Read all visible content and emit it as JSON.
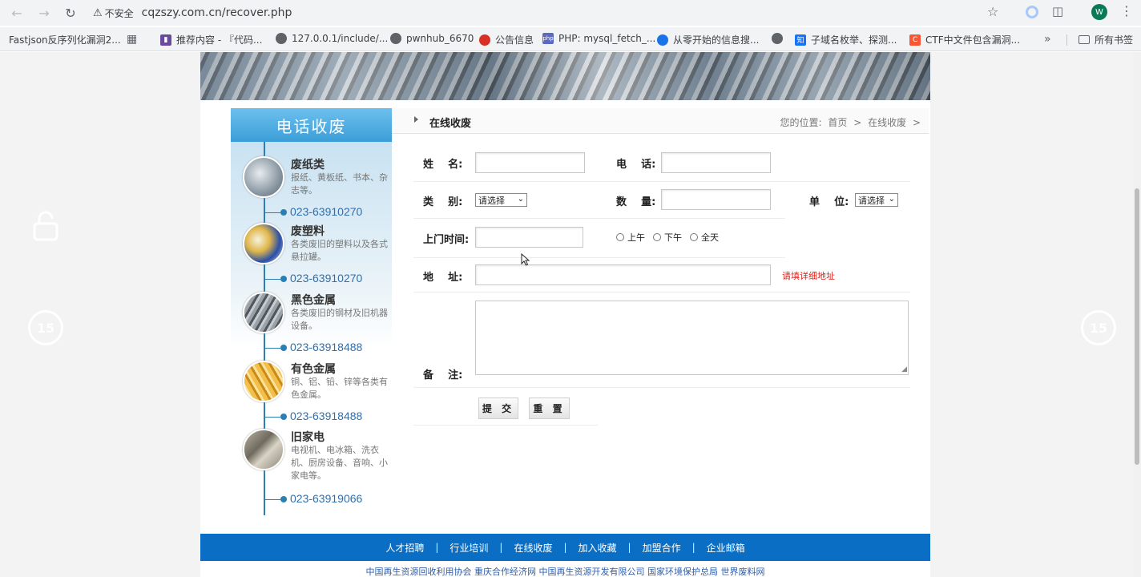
{
  "browser": {
    "security_label": "不安全",
    "url": "cqzszy.com.cn/recover.php",
    "profile_initial": "W",
    "bookmarks": [
      {
        "label": "Fastjson反序列化漏洞2...",
        "icon": "none"
      },
      {
        "label": "推荐内容 - 『代码...",
        "icon": "purple-page-icon"
      },
      {
        "label": "127.0.0.1/include/...",
        "icon": "globe-icon"
      },
      {
        "label": "pwnhub_6670",
        "icon": "globe-icon"
      },
      {
        "label": "公告信息",
        "icon": "red-icon"
      },
      {
        "label": "PHP: mysql_fetch_...",
        "icon": "php-icon"
      },
      {
        "label": "从零开始的信息搜...",
        "icon": "blue-circle-icon"
      },
      {
        "label": "",
        "icon": "globe-icon"
      },
      {
        "label": "子域名枚举、探测...",
        "icon": "zhihu-icon"
      },
      {
        "label": "CTF中文件包含漏洞...",
        "icon": "csdn-icon"
      }
    ],
    "all_bookmarks_label": "所有书签",
    "colors": {
      "chrome_bg": "#f1f3f4",
      "profile": "#0a7a55"
    }
  },
  "player": {
    "rewind_label": "15",
    "forward_label": "15"
  },
  "sidebar": {
    "header": "电话收废",
    "categories": [
      {
        "title": "废纸类",
        "desc": "报纸、黄板纸、书本、杂志等。",
        "phone": "023-63910270"
      },
      {
        "title": "废塑料",
        "desc": "各类废旧的塑料以及各式悬拉罐。",
        "phone": "023-63910270"
      },
      {
        "title": "黑色金属",
        "desc": "各类废旧的钢材及旧机器设备。",
        "phone": "023-63918488"
      },
      {
        "title": "有色金属",
        "desc": "铜、铝、铅、锌等各类有色金属。",
        "phone": "023-63918488"
      },
      {
        "title": "旧家电",
        "desc": "电视机、电冰箱、洗衣机、厨房设备、音响、小家电等。",
        "phone": "023-63919066"
      }
    ]
  },
  "main": {
    "section_title": "在线收废",
    "location_prefix": "您的位置:",
    "location_home": "首页",
    "location_sep": ">",
    "location_current": "在线收废",
    "form": {
      "name_label": "姓    名:",
      "phone_label": "电    话:",
      "category_label": "类    别:",
      "category_value": "请选择",
      "quantity_label": "数    量:",
      "unit_label": "单    位:",
      "unit_value": "请选择",
      "time_label": "上门时间:",
      "time_options": [
        "上午",
        "下午",
        "全天"
      ],
      "address_label": "地    址:",
      "address_hint": "请填详细地址",
      "remarks_label": "备    注:",
      "submit_label": "提 交",
      "reset_label": "重 置"
    }
  },
  "footer": {
    "links": [
      "人才招聘",
      "行业培训",
      "在线收废",
      "加入收藏",
      "加盟合作",
      "企业邮箱"
    ],
    "separator": "|",
    "bottom_text": "中国再生资源回收利用协会  重庆合作经济网  中国再生资源开发有限公司  国家环境保护总局  世界废料网"
  }
}
